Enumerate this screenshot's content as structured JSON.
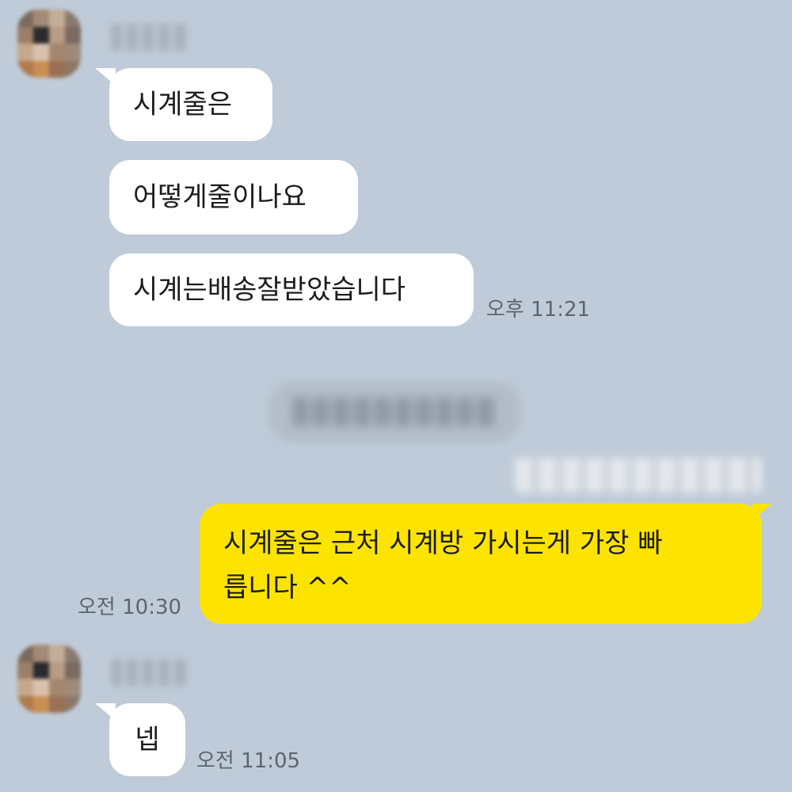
{
  "chat": {
    "messages_top": [
      {
        "text": "시계줄은"
      },
      {
        "text": "어떻게줄이나요"
      },
      {
        "text": "시계는배송잘받았습니다"
      }
    ],
    "time_top": "오후 11:21",
    "outgoing": {
      "line1": "시계줄은 근처 시계방 가시는게 가장 빠",
      "line2": "릅니다 ^^",
      "time": "오전 10:30"
    },
    "reply": {
      "text": "넵",
      "time": "오전 11:05"
    }
  },
  "colors": {
    "background": "#bfcbd9",
    "incoming_bubble": "#ffffff",
    "outgoing_bubble": "#fde400",
    "timestamp": "#5a6571"
  },
  "icons": {
    "avatar": "blurred-profile-photo"
  }
}
